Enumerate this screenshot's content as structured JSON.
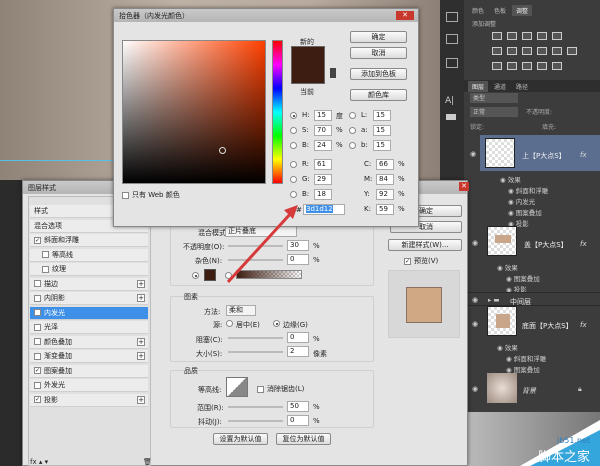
{
  "color_picker": {
    "title": "拾色器（内发光颜色）",
    "new_label": "新的",
    "current_label": "当前",
    "buttons": {
      "ok": "确定",
      "cancel": "取消",
      "add_swatch": "添加到色板",
      "color_libraries": "颜色库"
    },
    "new_color": "#3d1d12",
    "current_color": "#3d1d12",
    "hsb": [
      {
        "label": "H:",
        "value": "15",
        "unit": "度",
        "selected": true
      },
      {
        "label": "S:",
        "value": "70",
        "unit": "%"
      },
      {
        "label": "B:",
        "value": "24",
        "unit": "%"
      }
    ],
    "lab": [
      {
        "label": "L:",
        "value": "15"
      },
      {
        "label": "a:",
        "value": "15"
      },
      {
        "label": "b:",
        "value": "15"
      }
    ],
    "rgb": [
      {
        "label": "R:",
        "value": "61"
      },
      {
        "label": "G:",
        "value": "29"
      },
      {
        "label": "B:",
        "value": "18"
      }
    ],
    "cmyk": [
      {
        "label": "C:",
        "value": "66",
        "unit": "%"
      },
      {
        "label": "M:",
        "value": "84",
        "unit": "%"
      },
      {
        "label": "Y:",
        "value": "92",
        "unit": "%"
      },
      {
        "label": "K:",
        "value": "59",
        "unit": "%"
      }
    ],
    "hex_label": "#",
    "hex": "3d1d12",
    "web_only": "只有 Web 颜色"
  },
  "layer_style": {
    "title": "图层样式",
    "list": [
      {
        "label": "样式"
      },
      {
        "label": "混合选项"
      },
      {
        "label": "斜面和浮雕",
        "checked": true
      },
      {
        "label": "等高线",
        "indent": true
      },
      {
        "label": "纹理",
        "indent": true
      },
      {
        "label": "描边",
        "plus": true
      },
      {
        "label": "内阴影",
        "plus": true
      },
      {
        "label": "内发光",
        "checked": true,
        "selected": true
      },
      {
        "label": "光泽"
      },
      {
        "label": "颜色叠加",
        "plus": true
      },
      {
        "label": "渐变叠加",
        "plus": true
      },
      {
        "label": "图案叠加",
        "checked": true
      },
      {
        "label": "外发光"
      },
      {
        "label": "投影",
        "checked": true,
        "plus": true
      }
    ],
    "structure": {
      "blend_mode_label": "混合模式:",
      "blend_mode": "正片叠底",
      "opacity_label": "不透明度(O):",
      "opacity": "30",
      "noise_label": "杂色(N):",
      "noise": "0",
      "pct": "%"
    },
    "elements": {
      "heading": "图素",
      "method_label": "方法:",
      "method": "柔和",
      "source_label": "源:",
      "center": "居中(E)",
      "edge": "边缘(G)",
      "choke_label": "阻塞(C):",
      "choke": "0",
      "size_label": "大小(S):",
      "size": "2",
      "px": "像素"
    },
    "quality": {
      "heading": "品质",
      "contour_label": "等高线:",
      "antialias": "消除锯齿(L)",
      "range_label": "范围(R):",
      "range": "50",
      "jitter_label": "抖动(J):",
      "jitter": "0"
    },
    "make_default": "设置为默认值",
    "reset_default": "复位为默认值",
    "ok": "确定",
    "cancel": "取消",
    "new_style": "新建样式(W)...",
    "preview": "预览(V)"
  },
  "adjustments": {
    "tabs": [
      "颜色",
      "色板",
      "调整"
    ],
    "add_label": "添加调整"
  },
  "layers": {
    "tabs": [
      "图层",
      "通道",
      "路径"
    ],
    "kind": "类型",
    "blend": "正常",
    "opacity_label": "不透明度:",
    "lock_label": "锁定:",
    "fill_label": "填充:",
    "items": [
      {
        "name": "上【P大点S】",
        "effects_label": "效果",
        "effects": [
          "斜面和浮雕",
          "内发光",
          "图案叠加",
          "投影"
        ],
        "fx": "fx"
      },
      {
        "name": "盖【P大点S】",
        "effects_label": "效果",
        "effects": [
          "图案叠加",
          "投影"
        ],
        "fx": "fx"
      },
      {
        "name": "中间层",
        "group": true
      },
      {
        "name": "底面【P大点S】",
        "effects_label": "效果",
        "effects": [
          "斜面和浮雕",
          "图案叠加"
        ],
        "fx": "fx"
      },
      {
        "name": "背景"
      }
    ]
  },
  "watermark": {
    "site": "jb51.net",
    "name": "脚本之家"
  }
}
